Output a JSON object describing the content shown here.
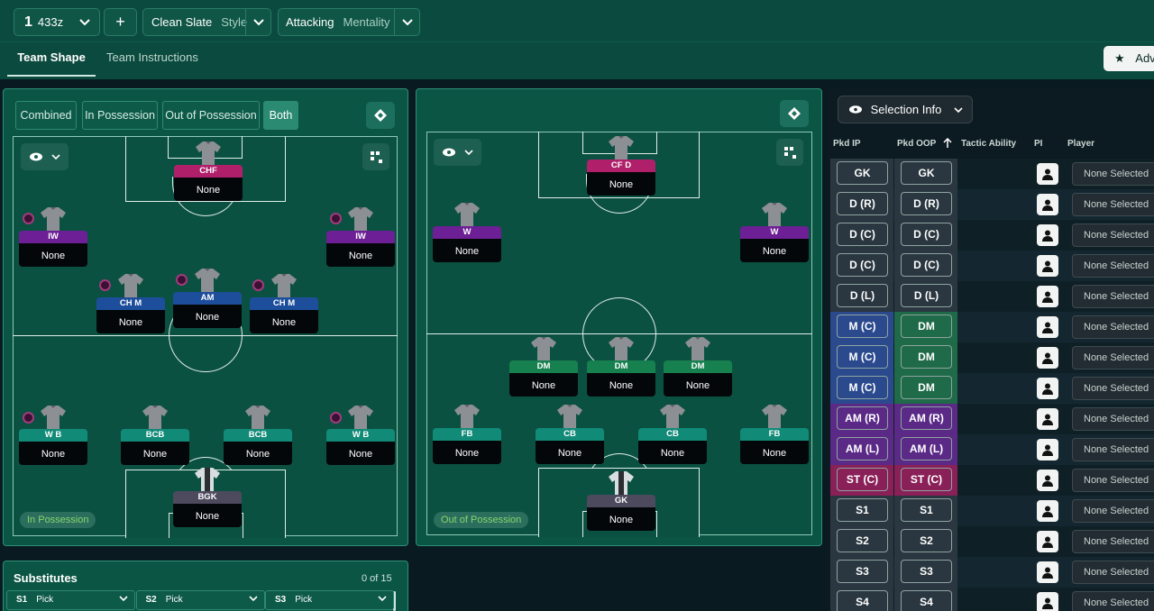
{
  "formation": {
    "number": "1",
    "name": "433z"
  },
  "add_label": "+",
  "style": {
    "value": "Clean Slate",
    "label": "Style"
  },
  "mentality": {
    "value": "Attacking",
    "label": "Mentality"
  },
  "tabs": {
    "team_shape": "Team Shape",
    "team_instructions": "Team Instructions"
  },
  "adv_label": "Adv",
  "view_modes": [
    "Combined",
    "In Possession",
    "Out of Possession",
    "Both"
  ],
  "in_possession_tag": "In Possession",
  "out_possession_tag": "Out of Possession",
  "in_possession_players": [
    {
      "role": "CHF",
      "name": "None"
    },
    {
      "role": "IW",
      "name": "None"
    },
    {
      "role": "IW",
      "name": "None"
    },
    {
      "role": "CH M",
      "name": "None"
    },
    {
      "role": "AM",
      "name": "None"
    },
    {
      "role": "CH M",
      "name": "None"
    },
    {
      "role": "W B",
      "name": "None"
    },
    {
      "role": "BCB",
      "name": "None"
    },
    {
      "role": "BCB",
      "name": "None"
    },
    {
      "role": "W B",
      "name": "None"
    },
    {
      "role": "BGK",
      "name": "None"
    }
  ],
  "out_possession_players": [
    {
      "role": "CF D",
      "name": "None"
    },
    {
      "role": "W",
      "name": "None"
    },
    {
      "role": "W",
      "name": "None"
    },
    {
      "role": "DM",
      "name": "None"
    },
    {
      "role": "DM",
      "name": "None"
    },
    {
      "role": "DM",
      "name": "None"
    },
    {
      "role": "FB",
      "name": "None"
    },
    {
      "role": "CB",
      "name": "None"
    },
    {
      "role": "CB",
      "name": "None"
    },
    {
      "role": "FB",
      "name": "None"
    },
    {
      "role": "GK",
      "name": "None"
    }
  ],
  "selection_info": "Selection Info",
  "columns": {
    "pkd_ip": "Pkd IP",
    "pkd_oop": "Pkd OOP",
    "tactic_ability": "Tactic Ability",
    "pi": "PI",
    "player": "Player"
  },
  "rows": [
    {
      "ip": "GK",
      "oop": "GK",
      "player": "None Selected",
      "ip_color": "#2a3740",
      "oop_color": "#2a3740"
    },
    {
      "ip": "D (R)",
      "oop": "D (R)",
      "player": "None Selected",
      "ip_color": "#2a3740",
      "oop_color": "#2a3740"
    },
    {
      "ip": "D (C)",
      "oop": "D (C)",
      "player": "None Selected",
      "ip_color": "#2a3740",
      "oop_color": "#2a3740"
    },
    {
      "ip": "D (C)",
      "oop": "D (C)",
      "player": "None Selected",
      "ip_color": "#2a3740",
      "oop_color": "#2a3740"
    },
    {
      "ip": "D (L)",
      "oop": "D (L)",
      "player": "None Selected",
      "ip_color": "#2a3740",
      "oop_color": "#2a3740"
    },
    {
      "ip": "M (C)",
      "oop": "DM",
      "player": "None Selected",
      "ip_color": "#2b4a8e",
      "oop_color": "#1f6a48"
    },
    {
      "ip": "M (C)",
      "oop": "DM",
      "player": "None Selected",
      "ip_color": "#2b4a8e",
      "oop_color": "#1f6a48"
    },
    {
      "ip": "M (C)",
      "oop": "DM",
      "player": "None Selected",
      "ip_color": "#2b4a8e",
      "oop_color": "#1f6a48"
    },
    {
      "ip": "AM (R)",
      "oop": "AM (R)",
      "player": "None Selected",
      "ip_color": "#5a2a86",
      "oop_color": "#5a2a86"
    },
    {
      "ip": "AM (L)",
      "oop": "AM (L)",
      "player": "None Selected",
      "ip_color": "#5a2a86",
      "oop_color": "#5a2a86"
    },
    {
      "ip": "ST (C)",
      "oop": "ST (C)",
      "player": "None Selected",
      "ip_color": "#8a2058",
      "oop_color": "#8a2058"
    },
    {
      "ip": "S1",
      "oop": "S1",
      "player": "None Selected",
      "ip_color": "#2a3740",
      "oop_color": "#2a3740"
    },
    {
      "ip": "S2",
      "oop": "S2",
      "player": "None Selected",
      "ip_color": "#2a3740",
      "oop_color": "#2a3740"
    },
    {
      "ip": "S3",
      "oop": "S3",
      "player": "None Selected",
      "ip_color": "#2a3740",
      "oop_color": "#2a3740"
    },
    {
      "ip": "S4",
      "oop": "S4",
      "player": "None Selected",
      "ip_color": "#2a3740",
      "oop_color": "#2a3740"
    }
  ],
  "substitutes": {
    "title": "Substitutes",
    "count": "0 of 15",
    "slots": [
      {
        "id": "S1",
        "value": "Pick"
      },
      {
        "id": "S2",
        "value": "Pick"
      },
      {
        "id": "S3",
        "value": "Pick"
      }
    ]
  }
}
